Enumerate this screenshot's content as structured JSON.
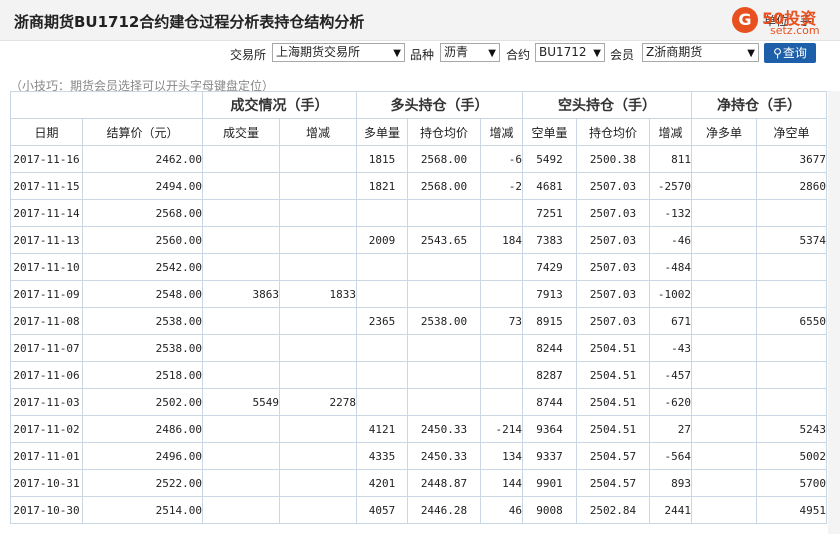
{
  "header": {
    "title": "浙商期货BU1712合约建仓过程分析表持仓结构分析",
    "unit": "单位：手",
    "logo": {
      "brand": "50投资",
      "domain": "setz.com",
      "glyph": "G"
    }
  },
  "filters": {
    "exchange_label": "交易所",
    "exchange_value": "上海期货交易所",
    "product_label": "品种",
    "product_value": "沥青",
    "contract_label": "合约",
    "contract_value": "BU1712",
    "member_label": "会员",
    "member_value": "Z浙商期货",
    "query_label": "查询"
  },
  "tip": "（小技巧：期货会员选择可以开头字母键盘定位）",
  "table": {
    "groups": [
      "成交情况（手）",
      "多头持仓（手）",
      "空头持仓（手）",
      "净持仓（手）"
    ],
    "columns": [
      "日期",
      "结算价（元）",
      "成交量",
      "增减",
      "多单量",
      "持仓均价",
      "增减",
      "空单量",
      "持仓均价",
      "增减",
      "净多单",
      "净空单"
    ],
    "rows": [
      [
        "2017-11-16",
        "2462.00",
        "",
        "",
        "1815",
        "2568.00",
        "-6",
        "5492",
        "2500.38",
        "811",
        "",
        "3677"
      ],
      [
        "2017-11-15",
        "2494.00",
        "",
        "",
        "1821",
        "2568.00",
        "-2",
        "4681",
        "2507.03",
        "-2570",
        "",
        "2860"
      ],
      [
        "2017-11-14",
        "2568.00",
        "",
        "",
        "",
        "",
        "",
        "7251",
        "2507.03",
        "-132",
        "",
        ""
      ],
      [
        "2017-11-13",
        "2560.00",
        "",
        "",
        "2009",
        "2543.65",
        "184",
        "7383",
        "2507.03",
        "-46",
        "",
        "5374"
      ],
      [
        "2017-11-10",
        "2542.00",
        "",
        "",
        "",
        "",
        "",
        "7429",
        "2507.03",
        "-484",
        "",
        ""
      ],
      [
        "2017-11-09",
        "2548.00",
        "3863",
        "1833",
        "",
        "",
        "",
        "7913",
        "2507.03",
        "-1002",
        "",
        ""
      ],
      [
        "2017-11-08",
        "2538.00",
        "",
        "",
        "2365",
        "2538.00",
        "73",
        "8915",
        "2507.03",
        "671",
        "",
        "6550"
      ],
      [
        "2017-11-07",
        "2538.00",
        "",
        "",
        "",
        "",
        "",
        "8244",
        "2504.51",
        "-43",
        "",
        ""
      ],
      [
        "2017-11-06",
        "2518.00",
        "",
        "",
        "",
        "",
        "",
        "8287",
        "2504.51",
        "-457",
        "",
        ""
      ],
      [
        "2017-11-03",
        "2502.00",
        "5549",
        "2278",
        "",
        "",
        "",
        "8744",
        "2504.51",
        "-620",
        "",
        ""
      ],
      [
        "2017-11-02",
        "2486.00",
        "",
        "",
        "4121",
        "2450.33",
        "-214",
        "9364",
        "2504.51",
        "27",
        "",
        "5243"
      ],
      [
        "2017-11-01",
        "2496.00",
        "",
        "",
        "4335",
        "2450.33",
        "134",
        "9337",
        "2504.57",
        "-564",
        "",
        "5002"
      ],
      [
        "2017-10-31",
        "2522.00",
        "",
        "",
        "4201",
        "2448.87",
        "144",
        "9901",
        "2504.57",
        "893",
        "",
        "5700"
      ],
      [
        "2017-10-30",
        "2514.00",
        "",
        "",
        "4057",
        "2446.28",
        "46",
        "9008",
        "2502.84",
        "2441",
        "",
        "4951"
      ]
    ]
  },
  "colors": {
    "increase": "#d6000c",
    "decrease": "#1a8a1a",
    "button": "#1d5fa8",
    "logo": "#e8511f"
  }
}
